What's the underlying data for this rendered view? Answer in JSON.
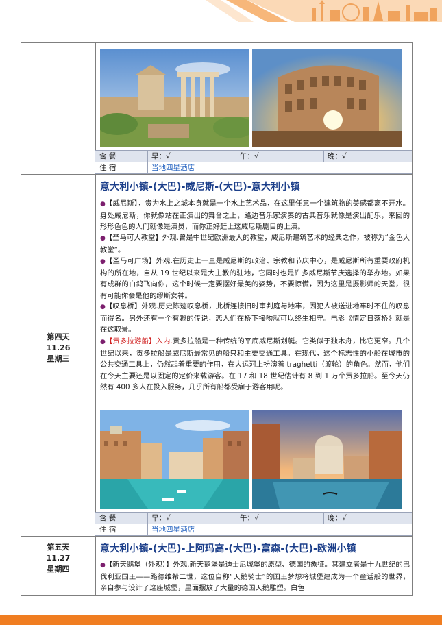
{
  "colors": {
    "accent_orange": "#f07d21",
    "title_blue": "#1c3f8a",
    "bullet_purple": "#7c1f6e",
    "highlight_red": "#d01f1f",
    "hotel_blue": "#1f5fbf",
    "meal_row_bg": "#dfe4ee"
  },
  "meals_labels": {
    "meal_label": "含 餐",
    "stay_label": "住 宿",
    "breakfast": "早：√",
    "lunch": "午：√",
    "dinner": "晚：√"
  },
  "day3": {
    "hotel": "当地四星酒店"
  },
  "day4": {
    "day": "第四天",
    "date": "11.26",
    "weekday": "星期三",
    "title": "意大利小镇-(大巴)-威尼斯-(大巴)-意大利小镇",
    "p1_head": "【威尼斯】",
    "p1_body": "，贵为水上之城本身就是一个水上艺术品，在这里任意一个建筑物的美感都离不开水。身处威尼斯，你就像站在正演出的舞台之上，路边音乐家演奏的古典音乐就像是演出配乐，来回的形形色色的人们就像是演员，而你正好赶上这威尼斯剧目的上演。",
    "p2_head": "【圣马可大教堂】",
    "p2_body": "外观.曾是中世纪欧洲最大的教堂，威尼斯建筑艺术的经典之作，被称为“金色大教堂”。",
    "p3_head": "【圣马可广场】",
    "p3_body": "外观.在历史上一直是威尼斯的政治、宗教和节庆中心，是威尼斯所有重要政府机构的所在地，自从 19 世纪以来是大主教的驻地，它同时也是许多威尼斯节庆选择的举办地。如果有成群的白鸽飞向你，这个时候一定要摆好最美的姿势，不要惊慌，因为这里是摄影师的天堂，很有可能你会是他的缪斯女神。",
    "p4_head": "【叹息桥】",
    "p4_body": "外观.历史陈迹叹息桥，此桥连接旧时审判庭与地牢，因犯人被送进地牢时不住的叹息而得名。另外还有一个有趣的传说，恋人们在桥下接吻就可以终生相守。电影《情定日落桥》就是在这取景。",
    "p5_head": "【贡多拉游船】入内.",
    "p5_body": "贡多拉船是一种传统的平底威尼斯划艇。它类似于独木舟，比它更窄。几个世纪以来，贡多拉船是威尼斯最常见的船只和主要交通工具。在现代，这个标志性的小船在城市的公共交通工具上，仍然起着重要的作用，在大运河上扮演着 traghetti（渡轮）的角色。然而，他们在今天主要还是以固定的定价来载游客。在 17 和 18 世纪估计有 8 到 1 万个贡多拉船。至今天仍然有 400 多人在投入服务，几乎所有船都受雇于游客用呢。",
    "hotel": "当地四星酒店"
  },
  "day5": {
    "day": "第五天",
    "date": "11.27",
    "weekday": "星期四",
    "title": "意大利小镇-(大巴)-上阿玛高-(大巴)-富森-(大巴)-欧洲小镇",
    "p1_head": "【新天鹅堡（外观）】",
    "p1_body": "外观.新天鹅堡是迪士尼城堡的原型、德国的象征。其建立者是十九世纪的巴伐利亚国王——路德维希二世，这位自称“天鹅骑士”的国王梦想将城堡建成为一个童话般的世界，亲自参与设计了这座城堡，里面摆放了大量的德国天鹅雕塑。白色"
  }
}
